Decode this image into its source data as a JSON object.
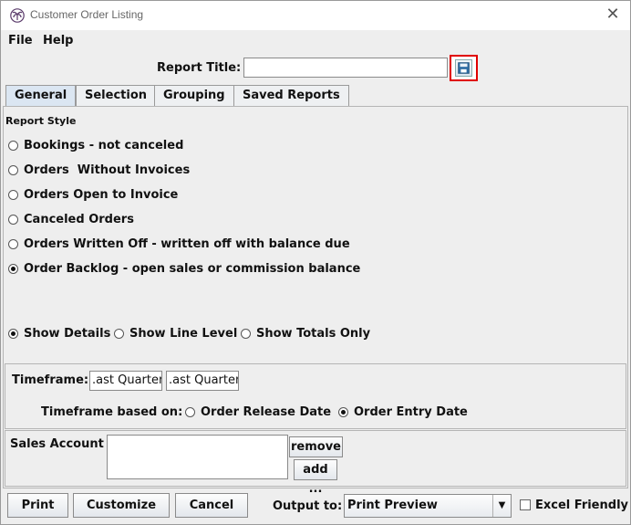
{
  "window": {
    "title": "Customer Order Listing",
    "close_symbol": "✕"
  },
  "menu": {
    "file": "File",
    "help": "Help"
  },
  "report_title": {
    "label": "Report Title:",
    "value": ""
  },
  "tabs": [
    "General",
    "Selection",
    "Grouping",
    "Saved Reports"
  ],
  "general": {
    "report_style_label": "Report Style",
    "styles": [
      {
        "label": "Bookings - not canceled",
        "selected": false
      },
      {
        "label": "Orders  Without Invoices",
        "selected": false
      },
      {
        "label": "Orders Open to Invoice",
        "selected": false
      },
      {
        "label": "Canceled Orders",
        "selected": false
      },
      {
        "label": "Orders Written Off - written off with balance due",
        "selected": false
      },
      {
        "label": "Order Backlog - open sales or commission balance",
        "selected": true
      }
    ],
    "detail_options": [
      {
        "label": "Show Details",
        "selected": true
      },
      {
        "label": "Show Line Level",
        "selected": false
      },
      {
        "label": "Show Totals Only",
        "selected": false
      }
    ],
    "timeframe": {
      "label": "Timeframe:",
      "from": ".ast Quarter",
      "to": ".ast Quarter",
      "based_on_label": "Timeframe based on:",
      "options": [
        {
          "label": "Order Release Date",
          "selected": false
        },
        {
          "label": "Order Entry Date",
          "selected": true
        }
      ]
    },
    "sales_account": {
      "label": "Sales Account",
      "remove": "remove",
      "add": "add ..."
    }
  },
  "footer": {
    "print": "Print",
    "customize": "Customize",
    "cancel": "Cancel",
    "output_label": "Output to:",
    "output_value": "Print Preview",
    "excel_label": "Excel Friendly",
    "excel_checked": false
  },
  "icons": {
    "app": "palm-icon",
    "save": "save-disk-icon",
    "dropdown": "chevron-down-icon"
  },
  "colors": {
    "highlight_border": "#e00000",
    "active_tab": "#dbe6f2"
  }
}
